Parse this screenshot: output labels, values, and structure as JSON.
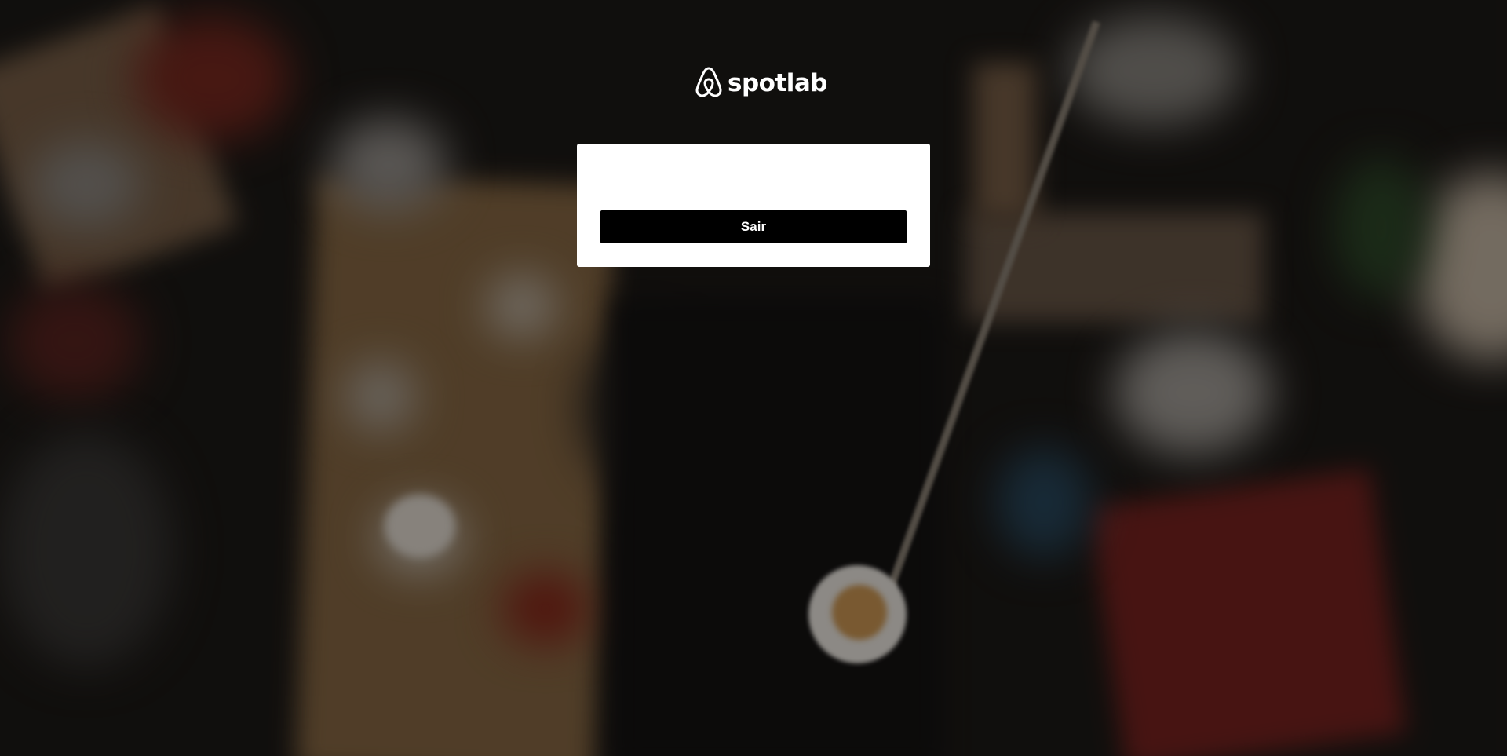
{
  "brand": {
    "name": "spotlab",
    "logo_icon": "airbnb-belo-icon"
  },
  "card": {
    "exit_label": "Sair"
  }
}
